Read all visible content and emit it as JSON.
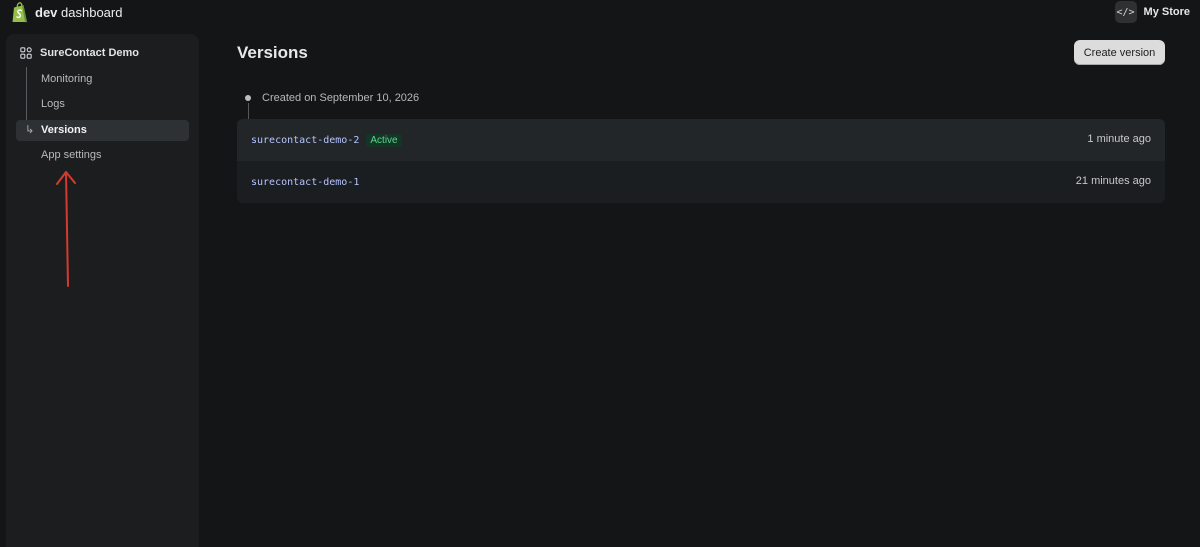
{
  "header": {
    "brand_bold": "dev",
    "brand_rest": "dashboard",
    "store_name": "My Store",
    "code_icon_text": "</>"
  },
  "sidebar": {
    "app_name": "SureContact Demo",
    "items": [
      {
        "label": "Monitoring",
        "active": false
      },
      {
        "label": "Logs",
        "active": false
      },
      {
        "label": "Versions",
        "active": true
      },
      {
        "label": "App settings",
        "active": false
      }
    ],
    "active_arrow": "↳"
  },
  "main": {
    "title": "Versions",
    "create_button": "Create version",
    "created_on": "Created on September 10, 2026",
    "versions": [
      {
        "name": "surecontact-demo-2",
        "badge": "Active",
        "time": "1 minute ago"
      },
      {
        "name": "surecontact-demo-1",
        "badge": "",
        "time": "21 minutes ago"
      }
    ]
  },
  "colors": {
    "background": "#141516",
    "sidebar": "#1b1d1f",
    "active_badge_text": "#5ad68d",
    "annotation_arrow": "#d63a2f",
    "shopify_green": "#95bf47"
  }
}
